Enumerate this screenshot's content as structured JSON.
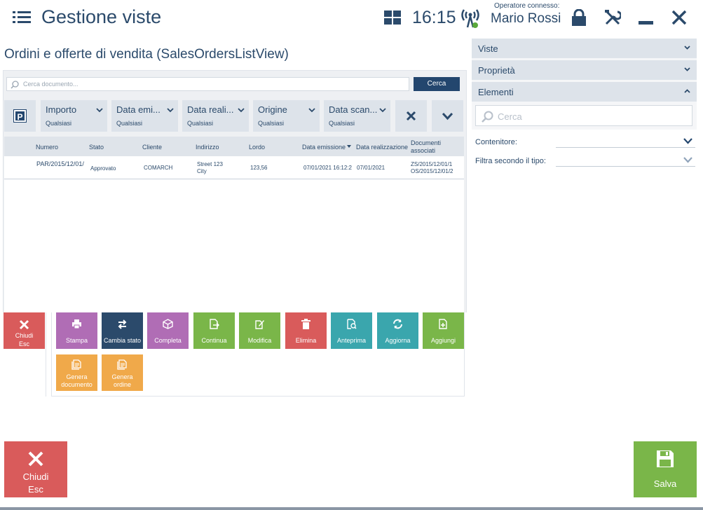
{
  "header": {
    "title": "Gestione viste",
    "time": "16:15",
    "operator_caption": "Operatore connesso:",
    "operator_name": "Mario Rossi"
  },
  "view": {
    "title": "Ordini e offerte di vendita (SalesOrdersListView)",
    "search_placeholder": "Cerca documento...",
    "search_button": "Cerca"
  },
  "filters": [
    {
      "label": "Importo",
      "value": "Qualsiasi"
    },
    {
      "label": "Data emi...",
      "value": "Qualsiasi"
    },
    {
      "label": "Data reali...",
      "value": "Qualsiasi"
    },
    {
      "label": "Origine",
      "value": "Qualsiasi"
    },
    {
      "label": "Data scan...",
      "value": "Qualsiasi"
    }
  ],
  "filter_p_label": "P",
  "grid": {
    "columns": [
      "Numero",
      "Stato",
      "Cliente",
      "Indirizzo",
      "Lordo",
      "Data emissione",
      "Data realizzazione",
      "Documenti",
      "associati"
    ],
    "row": {
      "numero": "PAR/2015/12/01/",
      "stato": "Approvato",
      "cliente": "COMARCH",
      "indirizzo_1": "Street 123",
      "indirizzo_2": "City",
      "lordo": "123,56",
      "data_emissione": "07/01/2021 16:12:2",
      "data_realizzazione": "07/01/2021",
      "documenti_1": "ZS/2015/12/01/1",
      "documenti_2": "OS/2015/12/01/2"
    }
  },
  "actions": {
    "close_1": "Chiudi",
    "close_2": "Esc",
    "stampa": "Stampa",
    "cambia_stato": "Cambia stato",
    "completa": "Completa",
    "continua": "Continua",
    "modifica": "Modifica",
    "elimina": "Elimina",
    "anteprima": "Anteprima",
    "aggiorna": "Aggiorna",
    "aggiungi": "Aggiungi",
    "genera_documento_1": "Genera",
    "genera_documento_2": "documento",
    "genera_ordine_1": "Genera",
    "genera_ordine_2": "ordine"
  },
  "sidebar": {
    "viste": "Viste",
    "proprieta": "Proprietà",
    "elementi": "Elementi",
    "search_placeholder": "Cerca",
    "contenitore": "Contenitore:",
    "filtra": "Filtra secondo il tipo:"
  },
  "footer": {
    "close_1": "Chiudi",
    "close_2": "Esc",
    "save": "Salva"
  },
  "colors": {
    "primary": "#23466e",
    "red": "#d95b5b",
    "purple": "#b06db5",
    "navy": "#2b4a6b",
    "green": "#7ab649",
    "teal": "#3aa6ad",
    "orange": "#f0a94a"
  }
}
